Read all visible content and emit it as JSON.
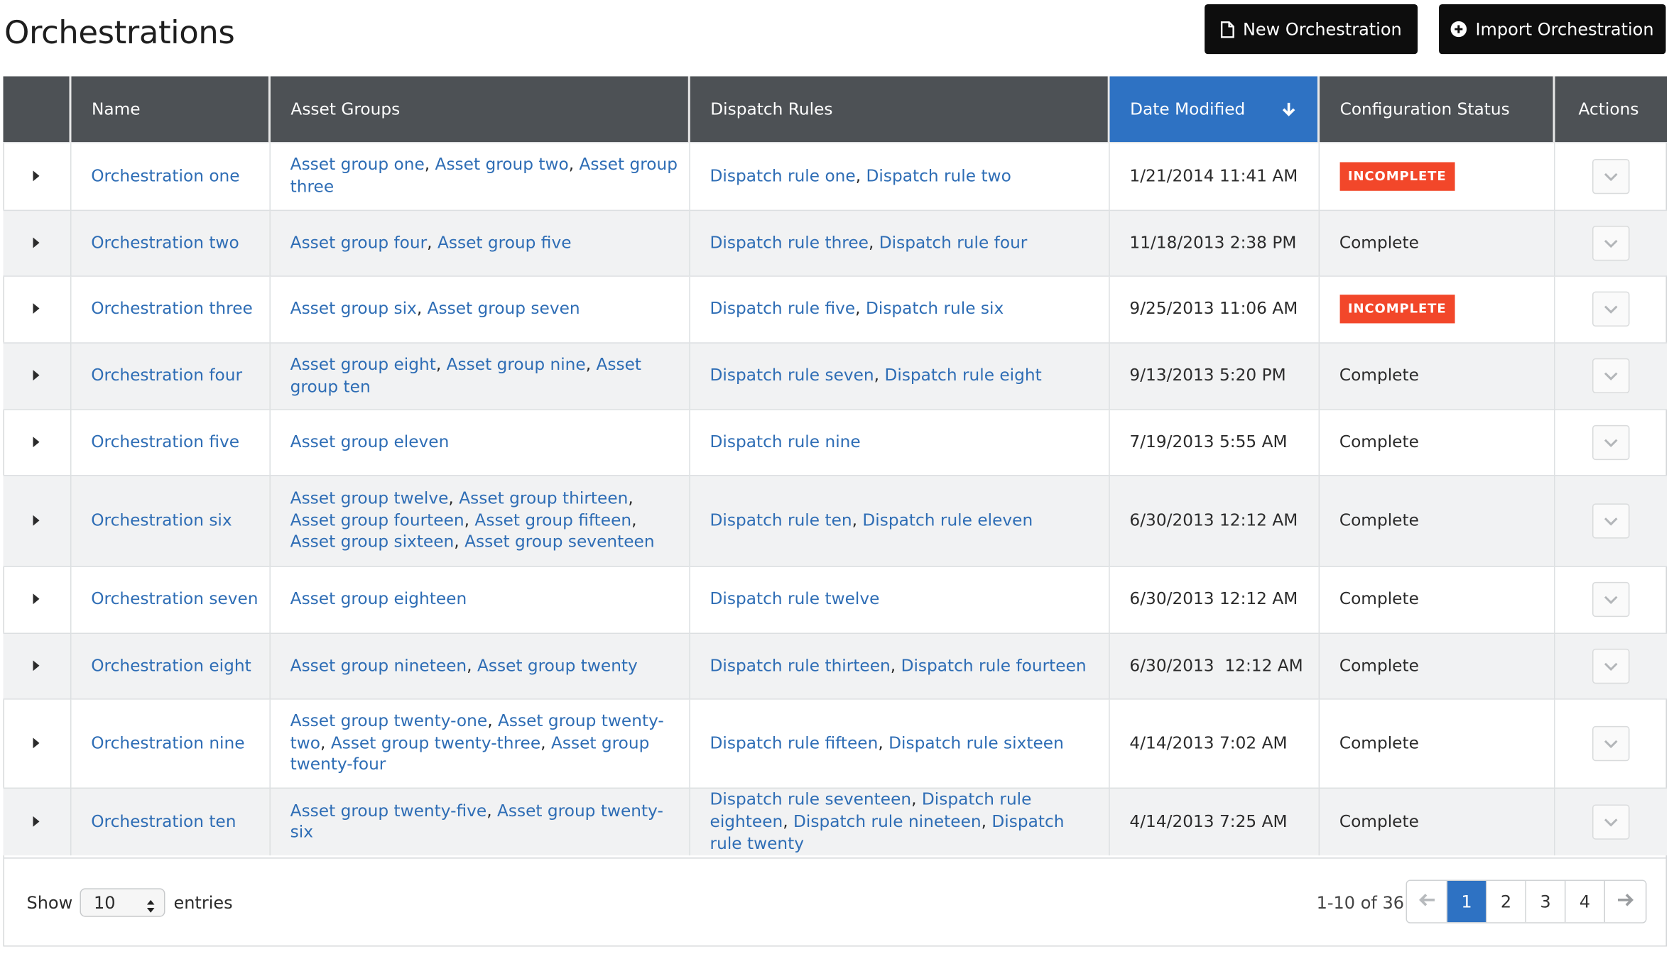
{
  "page": {
    "title": "Orchestrations"
  },
  "toolbar": {
    "new_label": "New Orchestration",
    "import_label": "Import Orchestration"
  },
  "table": {
    "columns": [
      "Name",
      "Asset Groups",
      "Dispatch Rules",
      "Date Modified",
      "Configuration Status",
      "Actions"
    ],
    "sorted_column": "Date Modified",
    "rows": [
      {
        "name": "Orchestration one",
        "asset_groups": [
          "Asset group one",
          "Asset group two",
          "Asset group three"
        ],
        "dispatch_rules": [
          "Dispatch rule one",
          "Dispatch rule  two"
        ],
        "date": "1/21/2014 11:41 AM",
        "status": "INCOMPLETE"
      },
      {
        "name": "Orchestration two",
        "asset_groups": [
          "Asset group four",
          "Asset group five"
        ],
        "dispatch_rules": [
          "Dispatch rule three",
          "Dispatch rule four"
        ],
        "date": "11/18/2013 2:38 PM",
        "status": "Complete"
      },
      {
        "name": "Orchestration three",
        "asset_groups": [
          "Asset group six",
          "Asset group seven"
        ],
        "dispatch_rules": [
          "Dispatch rule five",
          "Dispatch rule six"
        ],
        "date": "9/25/2013 11:06 AM",
        "status": "INCOMPLETE"
      },
      {
        "name": "Orchestration four",
        "asset_groups": [
          "Asset group eight",
          "Asset group nine",
          "Asset group ten"
        ],
        "dispatch_rules": [
          "Dispatch rule seven",
          "Dispatch rule eight"
        ],
        "date": "9/13/2013 5:20 PM",
        "status": "Complete"
      },
      {
        "name": "Orchestration five",
        "asset_groups": [
          "Asset group eleven"
        ],
        "dispatch_rules": [
          "Dispatch rule nine"
        ],
        "date": "7/19/2013 5:55 AM",
        "status": "Complete"
      },
      {
        "name": "Orchestration six",
        "asset_groups": [
          "Asset group twelve",
          "Asset group thirteen",
          "Asset group fourteen",
          "Asset group fifteen",
          "Asset group sixteen",
          "Asset group seventeen"
        ],
        "dispatch_rules": [
          "Dispatch rule ten",
          "Dispatch rule eleven"
        ],
        "date": "6/30/2013 12:12 AM",
        "status": "Complete"
      },
      {
        "name": "Orchestration seven",
        "asset_groups": [
          "Asset group eighteen"
        ],
        "dispatch_rules": [
          "Dispatch rule twelve"
        ],
        "date": "6/30/2013 12:12 AM",
        "status": "Complete"
      },
      {
        "name": "Orchestration eight",
        "asset_groups": [
          "Asset group nineteen",
          "Asset group twenty"
        ],
        "dispatch_rules": [
          "Dispatch rule thirteen",
          "Dispatch rule fourteen"
        ],
        "date": "6/30/2013  12:12 AM",
        "status": "Complete"
      },
      {
        "name": "Orchestration nine",
        "asset_groups": [
          "Asset group twenty-one",
          "Asset group twenty-two",
          "Asset group twenty-three",
          "Asset group twenty-four"
        ],
        "dispatch_rules": [
          "Dispatch rule fifteen",
          "Dispatch rule sixteen"
        ],
        "date": "4/14/2013 7:02 AM",
        "status": "Complete"
      },
      {
        "name": "Orchestration ten",
        "asset_groups": [
          "Asset group twenty-five",
          "Asset group twenty-six"
        ],
        "dispatch_rules": [
          "Dispatch rule seventeen",
          "Dispatch rule eighteen",
          "Dispatch rule nineteen",
          "Dispatch rule twenty"
        ],
        "date": "4/14/2013 7:25 AM",
        "status": "Complete"
      }
    ]
  },
  "footer": {
    "show_label": "Show",
    "page_size": "10",
    "entries_label": "entries",
    "range_text": "1-10 of 36",
    "pages": [
      "1",
      "2",
      "3",
      "4"
    ],
    "current_page": "1"
  },
  "colors": {
    "header_bg": "#4d5155",
    "sorted_header_bg": "#2e72c3",
    "link": "#2e6db5",
    "incomplete_badge": "#f2472a",
    "button_bg": "#0d0d0d"
  },
  "icons": {
    "new_button": "document-icon",
    "import_button": "plus-circle-icon",
    "sort": "arrow-down-icon",
    "row_expand": "caret-right-icon",
    "row_action": "chevron-down-icon",
    "prev": "arrow-left-icon",
    "next": "arrow-right-icon"
  }
}
